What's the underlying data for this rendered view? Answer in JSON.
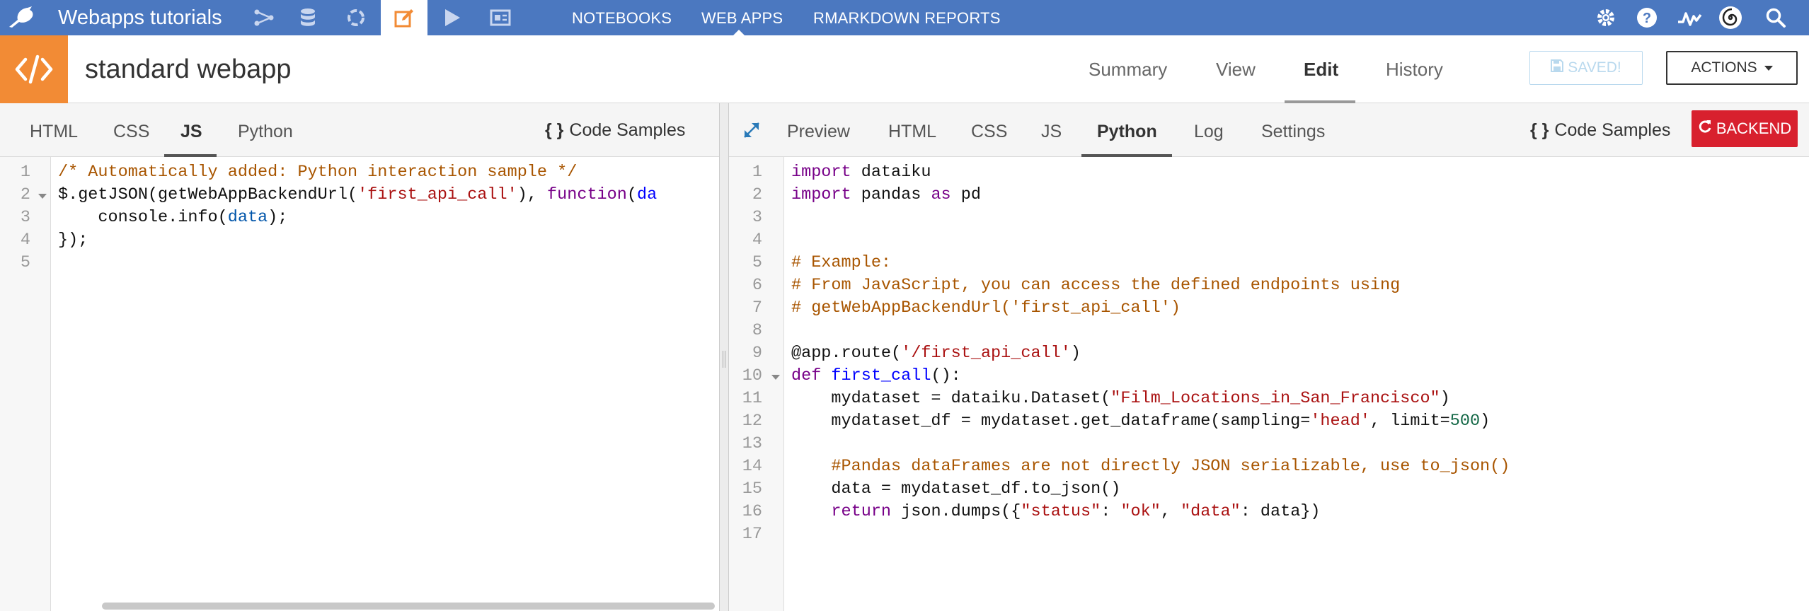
{
  "topnav": {
    "project": "Webapps tutorials",
    "menu": [
      "NOTEBOOKS",
      "WEB APPS",
      "RMARKDOWN REPORTS"
    ],
    "colors": {
      "bar": "#4b78c0",
      "active_icon": "#f28b35"
    }
  },
  "header": {
    "object_name": "standard webapp",
    "tabs": [
      "Summary",
      "View",
      "Edit",
      "History"
    ],
    "active_tab": "Edit",
    "saved_label": "SAVED!",
    "actions_label": "ACTIONS"
  },
  "left": {
    "tabs": [
      "HTML",
      "CSS",
      "JS",
      "Python"
    ],
    "active_tab": "JS",
    "code_samples": "Code Samples",
    "line_numbers": [
      "1",
      "2",
      "3",
      "4",
      "5"
    ]
  },
  "right": {
    "tabs": [
      "Preview",
      "HTML",
      "CSS",
      "JS",
      "Python",
      "Log",
      "Settings"
    ],
    "active_tab": "Python",
    "code_samples": "Code Samples",
    "backend_label": "BACKEND",
    "line_numbers": [
      "1",
      "2",
      "3",
      "4",
      "5",
      "6",
      "7",
      "8",
      "9",
      "10",
      "11",
      "12",
      "13",
      "14",
      "15",
      "16",
      "17"
    ]
  },
  "code": {
    "js": {
      "l1": "/* Automatically added: Python interaction sample */",
      "l2_a": "$.getJSON(getWebAppBackendUrl(",
      "l2_b": "'first_api_call'",
      "l2_c": "), ",
      "l2_d": "function",
      "l2_e": "(",
      "l2_f": "da",
      "l3_a": "    console.info(",
      "l3_b": "data",
      "l3_c": ");",
      "l4": "});"
    },
    "py": {
      "l1_a": "import",
      "l1_b": " dataiku",
      "l2_a": "import",
      "l2_b": " pandas ",
      "l2_c": "as",
      "l2_d": " pd",
      "l5": "# Example:",
      "l6": "# From JavaScript, you can access the defined endpoints using",
      "l7": "# getWebAppBackendUrl('first_api_call')",
      "l9_a": "@app.route(",
      "l9_b": "'/first_api_call'",
      "l9_c": ")",
      "l10_a": "def",
      "l10_b": " ",
      "l10_c": "first_call",
      "l10_d": "():",
      "l11_a": "    mydataset = dataiku.Dataset(",
      "l11_b": "\"Film_Locations_in_San_Francisco\"",
      "l11_c": ")",
      "l12_a": "    mydataset_df = mydataset.get_dataframe(sampling=",
      "l12_b": "'head'",
      "l12_c": ", limit=",
      "l12_d": "500",
      "l12_e": ")",
      "l14": "    #Pandas dataFrames are not directly JSON serializable, use to_json()",
      "l15": "    data = mydataset_df.to_json()",
      "l16_a": "    ",
      "l16_b": "return",
      "l16_c": " json.dumps({",
      "l16_d": "\"status\"",
      "l16_e": ": ",
      "l16_f": "\"ok\"",
      "l16_g": ", ",
      "l16_h": "\"data\"",
      "l16_i": ": data})"
    }
  },
  "icons": [
    "bird-logo-icon",
    "flow-icon",
    "datasets-icon",
    "recipes-icon",
    "notebooks-edit-icon",
    "run-icon",
    "dashboard-icon",
    "settings-gear-icon",
    "help-icon",
    "activity-icon",
    "spiral-icon",
    "search-icon",
    "code-icon",
    "floppy-icon",
    "refresh-icon",
    "expand-icon"
  ]
}
